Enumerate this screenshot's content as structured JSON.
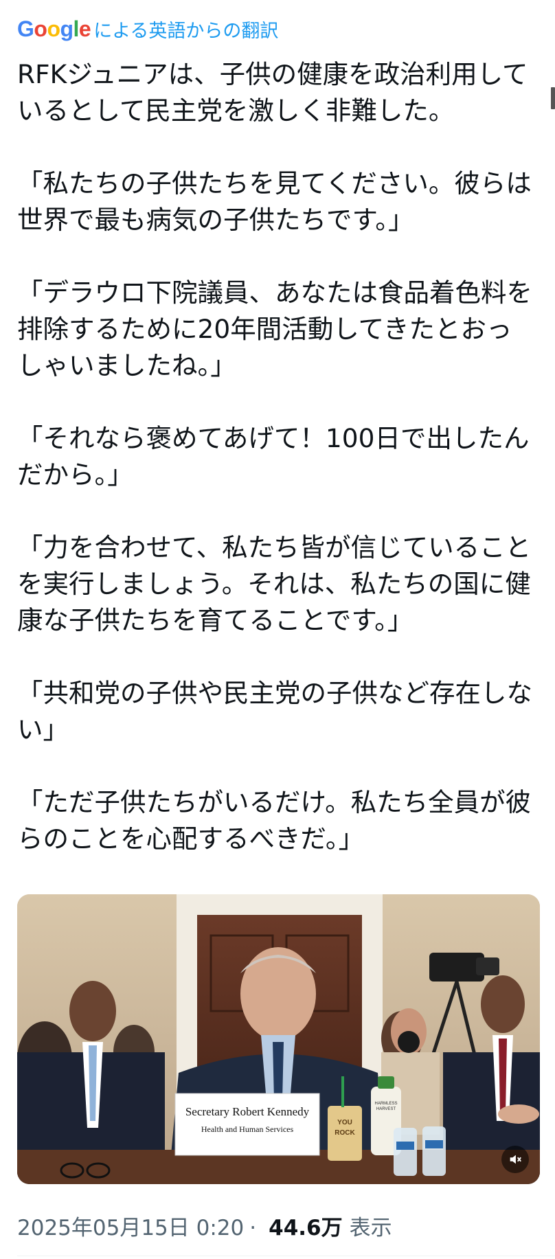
{
  "translation": {
    "google_letters": [
      {
        "ch": "G",
        "color": "#4285F4"
      },
      {
        "ch": "o",
        "color": "#EA4335"
      },
      {
        "ch": "o",
        "color": "#FBBC05"
      },
      {
        "ch": "g",
        "color": "#4285F4"
      },
      {
        "ch": "l",
        "color": "#34A853"
      },
      {
        "ch": "e",
        "color": "#EA4335"
      }
    ],
    "label": "による英語からの翻訳",
    "accent_color": "#1d9bf0"
  },
  "tweet": {
    "paragraphs": [
      "RFKジュニアは、子供の健康を政治利用しているとして民主党を激しく非難した。",
      "「私たちの子供たちを見てください。彼らは世界で最も病気の子供たちです。」",
      "「デラウロ下院議員、あなたは食品着色料を排除するために20年間活動してきたとおっしゃいましたね。」",
      "「それなら褒めてあげて！100日で出したんだから。」",
      "「力を合わせて、私たち皆が信じていることを実行しましょう。それは、私たちの国に健康な子供たちを育てることです。」",
      "「共和党の子供や民主党の子供など存在しない」",
      "「ただ子供たちがいるだけ。私たち全員が彼らのことを心配するべきだ。」"
    ]
  },
  "media": {
    "placard_name": "Secretary Robert Kennedy",
    "placard_dept": "Health and Human Services",
    "bottle_label_1": "HARMLESS",
    "bottle_label_2": "HARVEST",
    "cup_text_1": "YOU",
    "cup_text_2": "ROCK",
    "mute_icon": "speaker-muted-icon"
  },
  "meta": {
    "timestamp": "2025年05月15日 0:20",
    "separator": "·",
    "views_count": "44.6万",
    "views_label": "表示"
  }
}
